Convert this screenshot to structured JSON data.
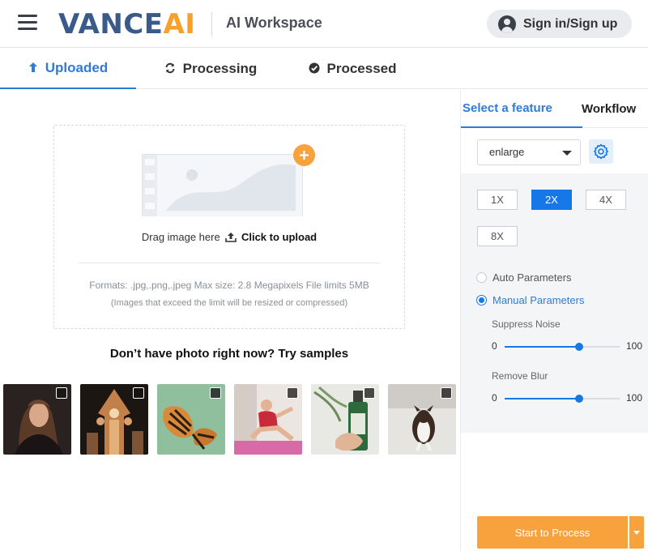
{
  "header": {
    "logo_main": "VANCE",
    "logo_accent": "AI",
    "workspace": "AI Workspace",
    "signin_label": "Sign in/Sign up"
  },
  "tabs": [
    {
      "label": "Uploaded",
      "icon": "arrow-up-icon",
      "active": true
    },
    {
      "label": "Processing",
      "icon": "refresh-icon",
      "active": false
    },
    {
      "label": "Processed",
      "icon": "check-circle-icon",
      "active": false
    }
  ],
  "upload": {
    "drag_text": "Drag image here",
    "click_text": "Click to upload",
    "formats": "Formats: .jpg,.png,.jpeg Max size: 2.8 Megapixels File limits 5MB",
    "note": "(Images that exceed the limit will be resized or compressed)"
  },
  "samples": {
    "title": "Don’t have photo right now? Try samples",
    "items": [
      "portrait-woman",
      "clock-tower",
      "butterfly",
      "yoga-woman",
      "green-bottle",
      "dog-in-snow"
    ]
  },
  "panel": {
    "tabs": [
      {
        "label": "Select a feature",
        "active": true
      },
      {
        "label": "Workflow",
        "active": false
      }
    ],
    "feature_select": "enlarge",
    "scales": [
      {
        "label": "1X",
        "active": false
      },
      {
        "label": "2X",
        "active": true
      },
      {
        "label": "4X",
        "active": false
      },
      {
        "label": "8X",
        "active": false
      }
    ],
    "params": [
      {
        "label": "Auto Parameters",
        "selected": false
      },
      {
        "label": "Manual Parameters",
        "selected": true
      }
    ],
    "sliders": [
      {
        "label": "Suppress Noise",
        "min": "0",
        "max": "100",
        "value": 65
      },
      {
        "label": "Remove Blur",
        "min": "0",
        "max": "100",
        "value": 65
      }
    ],
    "start_label": "Start to Process"
  },
  "colors": {
    "accent_blue": "#2f7bd6",
    "primary_blue": "#1677e6",
    "orange": "#f7a23d",
    "logo_navy": "#3a5a8a"
  }
}
